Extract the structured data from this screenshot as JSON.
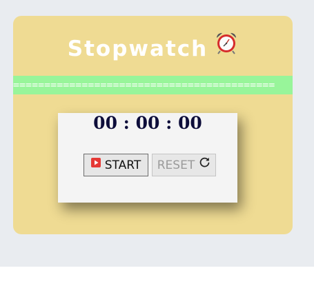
{
  "header": {
    "title": "Stopwatch",
    "title_icon": "alarm-clock-icon"
  },
  "divider": {
    "text": "=========================================="
  },
  "timer": {
    "display": "00 : 00 : 00"
  },
  "controls": {
    "start_label": "START",
    "start_icon": "play-button-icon",
    "reset_label": "RESET",
    "reset_icon": "refresh-icon"
  },
  "colors": {
    "page_background": "#e9ecf0",
    "card_background": "#efdb93",
    "divider_background": "#98f59a",
    "timer_text": "#0d0d3a",
    "play_icon": "#e53935"
  }
}
